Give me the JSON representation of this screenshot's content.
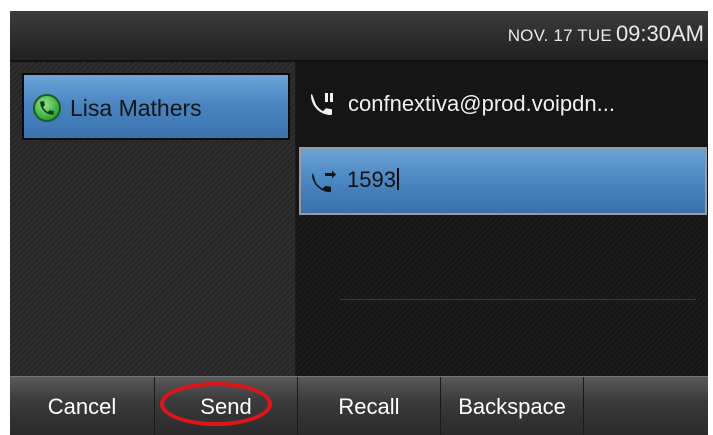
{
  "status_bar": {
    "date": "NOV. 17 TUE",
    "time": "09:30AM"
  },
  "line_key": {
    "label": "Lisa Mathers",
    "icon": "phone-handset-icon",
    "status_color": "#3bb146"
  },
  "active_call": {
    "remote_party": "confnextiva@prod.voipdn...",
    "icon": "phone-hold-icon"
  },
  "dial_entry": {
    "value": "1593",
    "icon": "phone-transfer-icon"
  },
  "softkeys": {
    "cancel": "Cancel",
    "send": "Send",
    "recall": "Recall",
    "backspace": "Backspace"
  },
  "annotation": {
    "highlight_color": "#e0151a",
    "highlighted_key": "Send"
  }
}
